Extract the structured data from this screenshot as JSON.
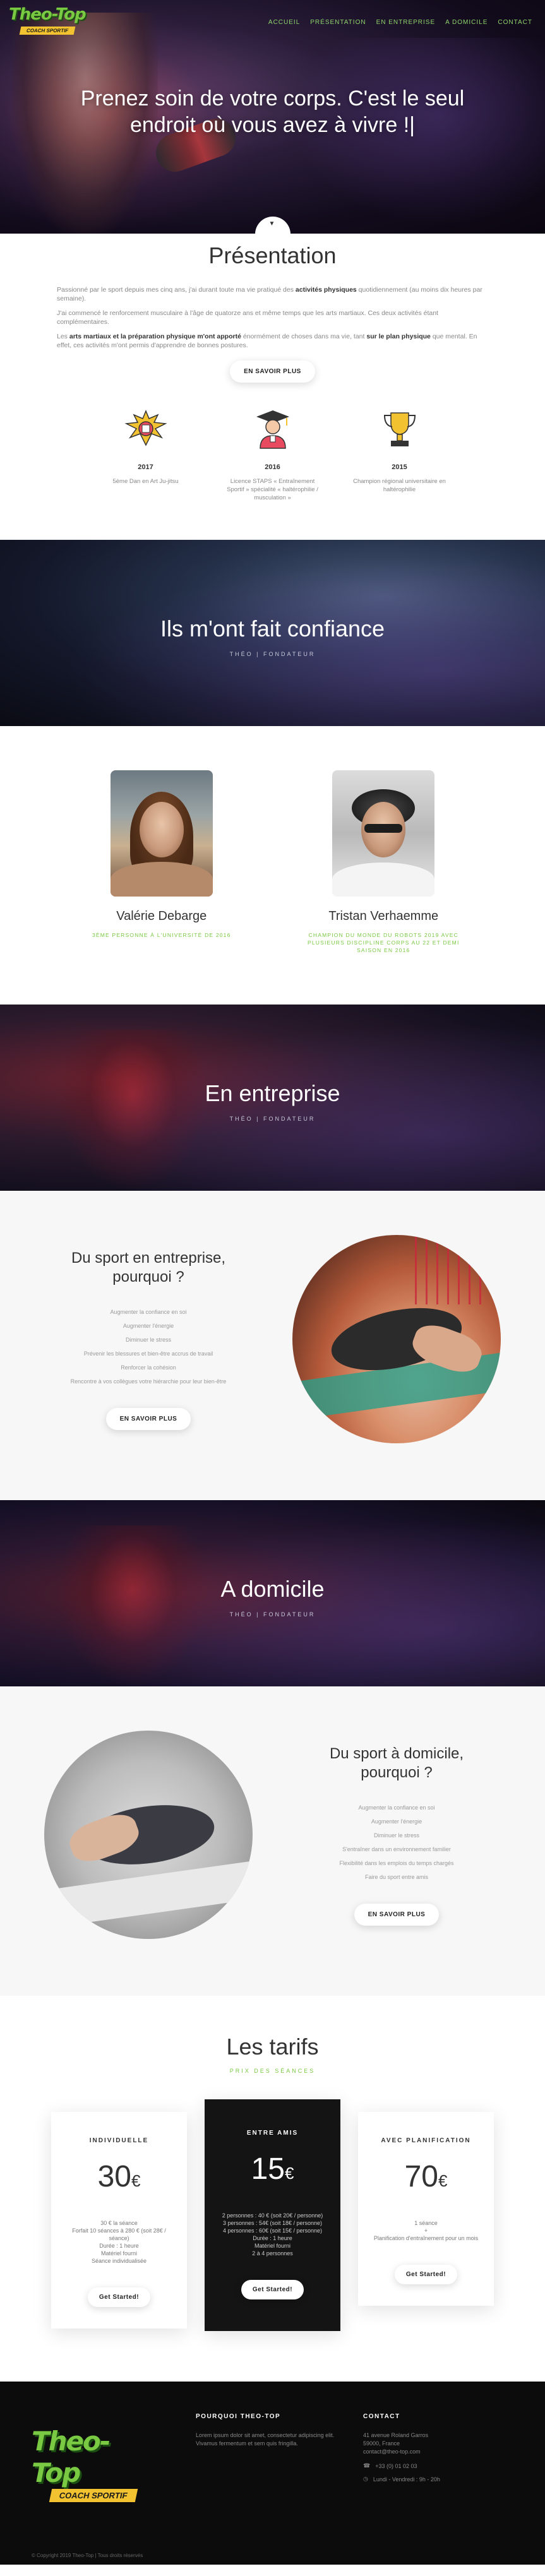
{
  "brand": {
    "name": "Theo-Top",
    "tagline": "COACH SPORTIF",
    "accent": "#7ac943",
    "gold": "#f2c230"
  },
  "nav": {
    "items": [
      "ACCUEIL",
      "PRÉSENTATION",
      "EN ENTREPRISE",
      "A DOMICILE",
      "CONTACT"
    ]
  },
  "hero": {
    "title": "Prenez soin de votre corps. C'est le seul endroit où vous avez à vivre !|",
    "scroll_icon": "chevron-down-icon"
  },
  "presentation": {
    "title": "Présentation",
    "paragraph1_a": "Passionné par le sport depuis mes cinq ans, j'ai durant toute ma vie pratiqué des ",
    "paragraph1_b": "activités physiques",
    "paragraph1_c": " quotidiennement (au moins dix heures par semaine).",
    "paragraph2": "J'ai commencé le renforcement musculaire à l'âge de quatorze ans et même temps que les arts martiaux. Ces deux activités étant complémentaires.",
    "paragraph3_a": "Les ",
    "paragraph3_b": "arts martiaux et la préparation physique m'ont apporté",
    "paragraph3_c": " énormément de choses dans ma vie, tant ",
    "paragraph3_d": "sur le plan physique",
    "paragraph3_e": " que mental. En effet, ces activités m'ont permis d'apprendre de bonnes postures.",
    "button": "EN SAVOIR PLUS",
    "timeline": [
      {
        "year": "2017",
        "desc": "5ème Dan en Art Ju-jitsu",
        "icon": "trophy-burst-icon"
      },
      {
        "year": "2016",
        "desc": "Licence STAPS « Entraînement Sportif » spécialité « haltérophilie / musculation »",
        "icon": "graduate-icon"
      },
      {
        "year": "2015",
        "desc": "Champion régional universitaire en haltérophilie",
        "icon": "trophy-icon"
      }
    ]
  },
  "confidence": {
    "title": "Ils m'ont fait confiance",
    "subtitle": "THÉO | FONDATEUR",
    "people": [
      {
        "name": "Valérie Debarge",
        "role": "3ÈME PERSONNE À L'UNIVERSITÉ DE 2016"
      },
      {
        "name": "Tristan Verhaemme",
        "role": "CHAMPION DU MONDE DU ROBOTS 2019 AVEC PLUSIEURS DISCIPLINE CORPS AU 22 ET DEMI SAISON EN 2016"
      }
    ]
  },
  "enterprise_banner": {
    "title": "En entreprise",
    "subtitle": "THÉO | FONDATEUR"
  },
  "enterprise": {
    "title_line1": "Du sport en entreprise,",
    "title_line2": "pourquoi ?",
    "items": [
      "Augmenter la confiance en soi",
      "Augmenter l'énergie",
      "Diminuer le stress",
      "Prévenir les blessures et bien-être accrus de travail",
      "Renforcer la cohésion",
      "Rencontre à vos collègues votre hiérarchie pour leur bien-être"
    ],
    "button": "EN SAVOIR PLUS"
  },
  "home_banner": {
    "title": "A domicile",
    "subtitle": "THÉO | FONDATEUR"
  },
  "home": {
    "title_line1": "Du sport à domicile,",
    "title_line2": "pourquoi ?",
    "items": [
      "Augmenter la confiance en soi",
      "Augmenter l'énergie",
      "Diminuer le stress",
      "S'entraîner dans un environnement familier",
      "Flexibilité dans les emplois du temps chargés",
      "Faire du sport entre amis"
    ],
    "button": "EN SAVOIR PLUS"
  },
  "pricing": {
    "title": "Les tarifs",
    "subtitle": "PRIX DES SÉANCES",
    "currency": "€",
    "plans": [
      {
        "name": "INDIVIDUELLE",
        "price": "30",
        "features": [
          "30 € la séance",
          "Forfait 10 séances à 280 € (soit 28€ / séance)",
          "Durée : 1 heure",
          "Matériel fourni",
          "Séance individualisée"
        ],
        "button": "Get Started!"
      },
      {
        "name": "ENTRE AMIS",
        "price": "15",
        "features": [
          "2 personnes : 40 € (soit 20€ / personne)",
          "3 personnes : 54€ (soit 18€ / personne)",
          "4 personnes : 60€ (soit 15€ / personne)",
          "Durée : 1 heure",
          "Matériel fourni",
          "2 à 4 personnes"
        ],
        "button": "Get Started!"
      },
      {
        "name": "AVEC PLANIFICATION",
        "price": "70",
        "features": [
          "1 séance",
          "+",
          "Planification d'entraînement pour un mois"
        ],
        "button": "Get Started!"
      }
    ]
  },
  "footer": {
    "about_title": "POURQUOI THEO-TOP",
    "about_text": "Lorem ipsum dolor sit amet, consectetur adipiscing elit. Vivamus fermentum et sem quis fringilla.",
    "contact_title": "CONTACT",
    "address_line1": "41 avenue Roland Garros",
    "address_line2": "59000, France",
    "email": "contact@theo-top.com",
    "phone": "+33 (0) 01 02 03",
    "hours": "Lundi - Vendredi : 9h - 20h",
    "copyright": "© Copyright 2019 Theo-Top | Tous droits réservés"
  }
}
